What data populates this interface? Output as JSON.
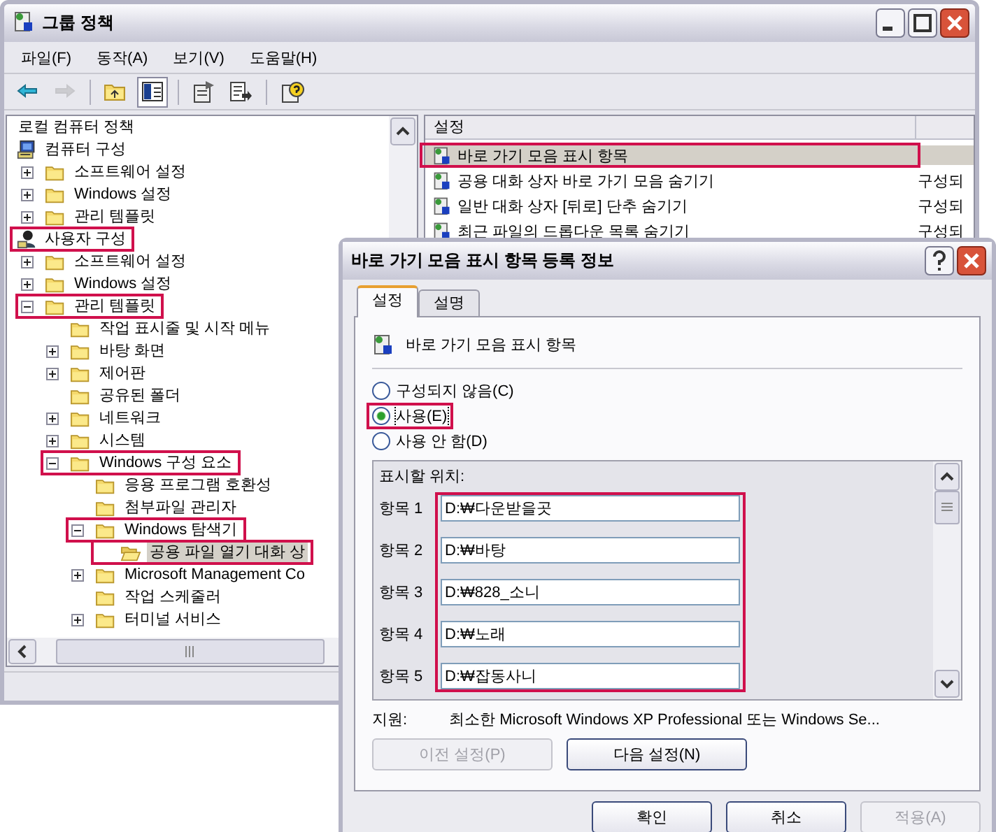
{
  "window": {
    "title": "그룹 정책"
  },
  "menu": [
    "파일(F)",
    "동작(A)",
    "보기(V)",
    "도움말(H)"
  ],
  "toolbar": [
    {
      "kind": "back",
      "disabled": false,
      "pressed": false
    },
    {
      "kind": "forward",
      "disabled": true,
      "pressed": false
    },
    {
      "kind": "separator"
    },
    {
      "kind": "up",
      "disabled": false,
      "pressed": false
    },
    {
      "kind": "tree",
      "disabled": false,
      "pressed": true
    },
    {
      "kind": "separator"
    },
    {
      "kind": "properties",
      "disabled": false,
      "pressed": false
    },
    {
      "kind": "export",
      "disabled": false,
      "pressed": false
    },
    {
      "kind": "separator"
    },
    {
      "kind": "help",
      "disabled": false,
      "pressed": false
    }
  ],
  "tree": [
    {
      "label": "로컬 컴퓨터 정책",
      "selected": false,
      "highlighted": false,
      "children": [
        {
          "label": "컴퓨터 구성",
          "kind": "computer",
          "selected": false,
          "highlighted": false,
          "children": [
            {
              "label": "소프트웨어 설정",
              "kind": "folder",
              "expanded": false,
              "selected": false,
              "highlighted": false
            },
            {
              "label": "Windows 설정",
              "kind": "folder",
              "expanded": false,
              "selected": false,
              "highlighted": false
            },
            {
              "label": "관리 템플릿",
              "kind": "folder",
              "expanded": false,
              "selected": false,
              "highlighted": false
            }
          ]
        },
        {
          "label": "사용자 구성",
          "kind": "user",
          "selected": false,
          "highlighted": true,
          "children": [
            {
              "label": "소프트웨어 설정",
              "kind": "folder",
              "expanded": false,
              "selected": false,
              "highlighted": false
            },
            {
              "label": "Windows 설정",
              "kind": "folder",
              "expanded": false,
              "selected": false,
              "highlighted": false
            },
            {
              "label": "관리 템플릿",
              "kind": "folder",
              "expanded": true,
              "selected": false,
              "highlighted": true,
              "children": [
                {
                  "label": "작업 표시줄 및 시작 메뉴",
                  "kind": "folder",
                  "selected": false,
                  "highlighted": false
                },
                {
                  "label": "바탕 화면",
                  "kind": "folder",
                  "expanded": false,
                  "selected": false,
                  "highlighted": false
                },
                {
                  "label": "제어판",
                  "kind": "folder",
                  "expanded": false,
                  "selected": false,
                  "highlighted": false
                },
                {
                  "label": "공유된 폴더",
                  "kind": "folder",
                  "selected": false,
                  "highlighted": false
                },
                {
                  "label": "네트워크",
                  "kind": "folder",
                  "expanded": false,
                  "selected": false,
                  "highlighted": false
                },
                {
                  "label": "시스템",
                  "kind": "folder",
                  "expanded": false,
                  "selected": false,
                  "highlighted": false
                },
                {
                  "label": "Windows 구성 요소",
                  "kind": "folder",
                  "expanded": true,
                  "selected": false,
                  "highlighted": true,
                  "children": [
                    {
                      "label": "응용 프로그램 호환성",
                      "kind": "folder",
                      "selected": false,
                      "highlighted": false
                    },
                    {
                      "label": "첨부파일 관리자",
                      "kind": "folder",
                      "selected": false,
                      "highlighted": false
                    },
                    {
                      "label": "Windows 탐색기",
                      "kind": "folder",
                      "expanded": true,
                      "selected": false,
                      "highlighted": true,
                      "children": [
                        {
                          "label": "공용 파일 열기 대화 상",
                          "kind": "folder",
                          "selected": true,
                          "highlighted": true
                        }
                      ]
                    },
                    {
                      "label": "Microsoft Management Co",
                      "kind": "folder",
                      "expanded": false,
                      "selected": false,
                      "highlighted": false
                    },
                    {
                      "label": "작업 스케줄러",
                      "kind": "folder",
                      "selected": false,
                      "highlighted": false
                    },
                    {
                      "label": "터미널 서비스",
                      "kind": "folder",
                      "expanded": false,
                      "selected": false,
                      "highlighted": false
                    }
                  ]
                }
              ]
            }
          ]
        }
      ]
    }
  ],
  "list": {
    "columns": [
      "설정"
    ],
    "rows": [
      {
        "name": "바로 가기 모음 표시 항목",
        "selected": true,
        "highlighted": true
      },
      {
        "name": "공용 대화 상자 바로 가기 모음 숨기기",
        "state": "구성되",
        "selected": false,
        "highlighted": false
      },
      {
        "name": "일반 대화 상자 [뒤로] 단추 숨기기",
        "state": "구성되",
        "selected": false,
        "highlighted": false
      },
      {
        "name": "최근 파일의 드롭다운 목록 숨기기",
        "state": "구성되",
        "selected": false,
        "highlighted": false
      }
    ]
  },
  "dialog": {
    "title": "바로 가기 모음 표시 항목 등록 정보",
    "tabs": [
      {
        "label": "설정",
        "selected": true
      },
      {
        "label": "설명",
        "selected": false
      }
    ],
    "policy_name": "바로 가기 모음 표시 항목",
    "options": [
      {
        "label": "구성되지 않음(C)",
        "selected": false,
        "highlighted": false
      },
      {
        "label": "사용(E)",
        "selected": true,
        "highlighted": true
      },
      {
        "label": "사용 안 함(D)",
        "selected": false,
        "highlighted": false
      }
    ],
    "locations": {
      "label": "표시할 위치:",
      "highlighted": true,
      "items": [
        {
          "label": "항목 1",
          "value": "D:₩다운받을곳"
        },
        {
          "label": "항목 2",
          "value": "D:₩바탕"
        },
        {
          "label": "항목 3",
          "value": "D:₩828_소니"
        },
        {
          "label": "항목 4",
          "value": "D:₩노래"
        },
        {
          "label": "항목 5",
          "value": "D:₩잡동사니"
        }
      ]
    },
    "support": {
      "label": "지원:",
      "text": "최소한 Microsoft Windows XP Professional 또는 Windows Se..."
    },
    "nav_buttons": [
      {
        "label": "이전 설정(P)",
        "disabled": true
      },
      {
        "label": "다음 설정(N)",
        "disabled": false
      }
    ],
    "buttons": [
      {
        "label": "확인",
        "disabled": false
      },
      {
        "label": "취소",
        "disabled": false
      },
      {
        "label": "적용(A)",
        "disabled": true
      }
    ]
  }
}
